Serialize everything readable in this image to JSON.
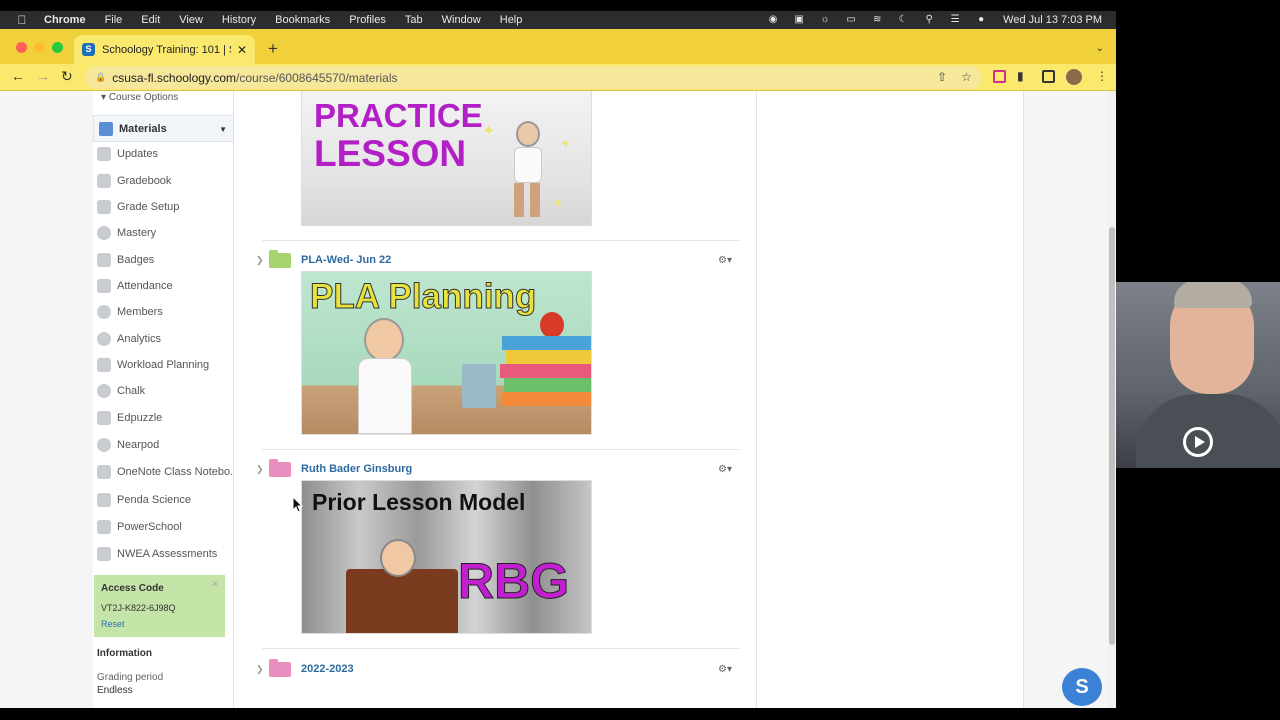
{
  "menubar": {
    "app": "Chrome",
    "items": [
      "File",
      "Edit",
      "View",
      "History",
      "Bookmarks",
      "Profiles",
      "Tab",
      "Window",
      "Help"
    ],
    "clock": "Wed Jul 13  7:03 PM"
  },
  "browser": {
    "tab_title": "Schoology Training: 101 | Schoo",
    "favicon_letter": "S",
    "url_domain": "csusa-fl.schoology.com",
    "url_path": "/course/6008645570/materials",
    "accent_color": "#f0d13c"
  },
  "sidebar": {
    "course_options": "Course Options",
    "active_item": "Materials",
    "items": [
      {
        "label": "Updates"
      },
      {
        "label": "Gradebook"
      },
      {
        "label": "Grade Setup"
      },
      {
        "label": "Mastery"
      },
      {
        "label": "Badges"
      },
      {
        "label": "Attendance"
      },
      {
        "label": "Members"
      },
      {
        "label": "Analytics"
      },
      {
        "label": "Workload Planning"
      },
      {
        "label": "Chalk"
      },
      {
        "label": "Edpuzzle"
      },
      {
        "label": "Nearpod"
      },
      {
        "label": "OneNote Class Notebo..."
      },
      {
        "label": "Penda Science"
      },
      {
        "label": "PowerSchool"
      },
      {
        "label": "NWEA Assessments"
      }
    ],
    "access_code": {
      "title": "Access Code",
      "code": "VT2J-K822-6J98Q",
      "reset": "Reset"
    },
    "info": {
      "title": "Information",
      "grading_period_label": "Grading period",
      "grading_period_value": "Endless"
    }
  },
  "materials": {
    "items": [
      {
        "title": "PLA-Wed- Jun 22",
        "folder_color": "#a8d46f",
        "image_text": "PLA Planning"
      },
      {
        "title": "Ruth Bader Ginsburg",
        "folder_color": "#e88fc0",
        "image_text": "Prior Lesson Model",
        "image_text_2": "RBG"
      },
      {
        "title": "2022-2023",
        "folder_color": "#e88fc0"
      }
    ],
    "top_image_text_1": "PRACTICE",
    "top_image_text_2": "LESSON"
  },
  "chat": {
    "letter": "S"
  }
}
